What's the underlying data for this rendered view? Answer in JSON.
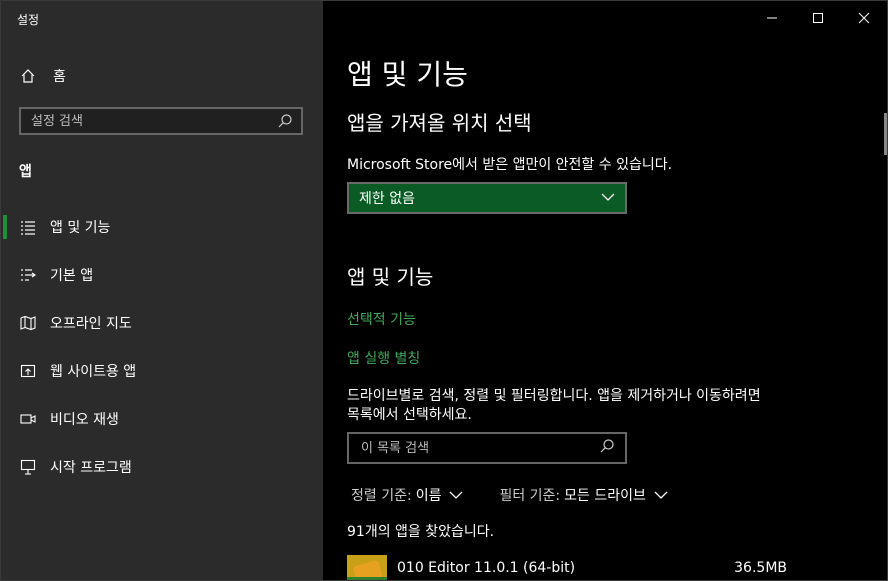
{
  "window": {
    "title": "설정"
  },
  "sidebar": {
    "home_label": "홈",
    "search_placeholder": "설정 검색",
    "section_label": "앱",
    "items": [
      {
        "label": "앱 및 기능",
        "icon": "list-icon",
        "active": true
      },
      {
        "label": "기본 앱",
        "icon": "default-apps-icon",
        "active": false
      },
      {
        "label": "오프라인 지도",
        "icon": "map-icon",
        "active": false
      },
      {
        "label": "웹 사이트용 앱",
        "icon": "open-in-app-icon",
        "active": false
      },
      {
        "label": "비디오 재생",
        "icon": "video-icon",
        "active": false
      },
      {
        "label": "시작 프로그램",
        "icon": "startup-icon",
        "active": false
      }
    ]
  },
  "main": {
    "page_title": "앱 및 기능",
    "source": {
      "heading": "앱을 가져올 위치 선택",
      "description": "Microsoft Store에서 받은 앱만이 안전할 수 있습니다.",
      "dropdown_value": "제한 없음"
    },
    "apps": {
      "heading": "앱 및 기능",
      "link_optional_features": "선택적 기능",
      "link_app_aliases": "앱 실행 별칭",
      "description_line1": "드라이브별로 검색, 정렬 및 필터링합니다. 앱을 제거하거나 이동하려면",
      "description_line2": "목록에서 선택하세요.",
      "search_placeholder": "이 목록 검색",
      "sort_label": "정렬 기준:",
      "sort_value": "이름",
      "filter_label": "필터 기준:",
      "filter_value": "모든 드라이브",
      "count_text": "91개의 앱을 찾았습니다.",
      "list": [
        {
          "name": "010 Editor 11.0.1 (64-bit)",
          "size": "36.5MB"
        }
      ]
    }
  },
  "colors": {
    "accent": "#1f8f3a",
    "link": "#3fa85a",
    "dropdown_bg": "#0a5c24",
    "sidebar_bg": "#2b2b2b"
  }
}
